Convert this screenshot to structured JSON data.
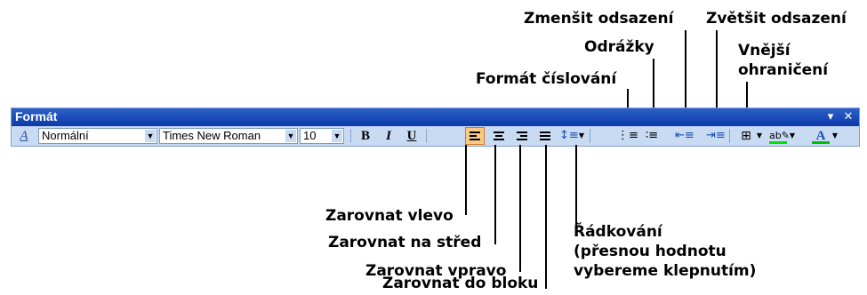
{
  "toolbar": {
    "title": "Formát",
    "style_value": "Normální",
    "font_value": "Times New Roman",
    "size_value": "10",
    "bold": "B",
    "italic": "I",
    "underline": "U",
    "font_color_letter": "A"
  },
  "callouts": {
    "zmensit": "Zmenšit odsazení",
    "zvetsit": "Zvětšit odsazení",
    "odrazky": "Odrážky",
    "vnejsi_line1": "Vnější",
    "vnejsi_line2": "ohraničení",
    "cislovani": "Formát číslování",
    "vlevo": "Zarovnat vlevo",
    "stred": "Zarovnat na střed",
    "vpravo": "Zarovnat vpravo",
    "blok": "Zarovnat do bloku",
    "radkovani_line1": "Řádkování",
    "radkovani_line2": "(přesnou hodnotu",
    "radkovani_line3": "vybereme klepnutím)"
  }
}
